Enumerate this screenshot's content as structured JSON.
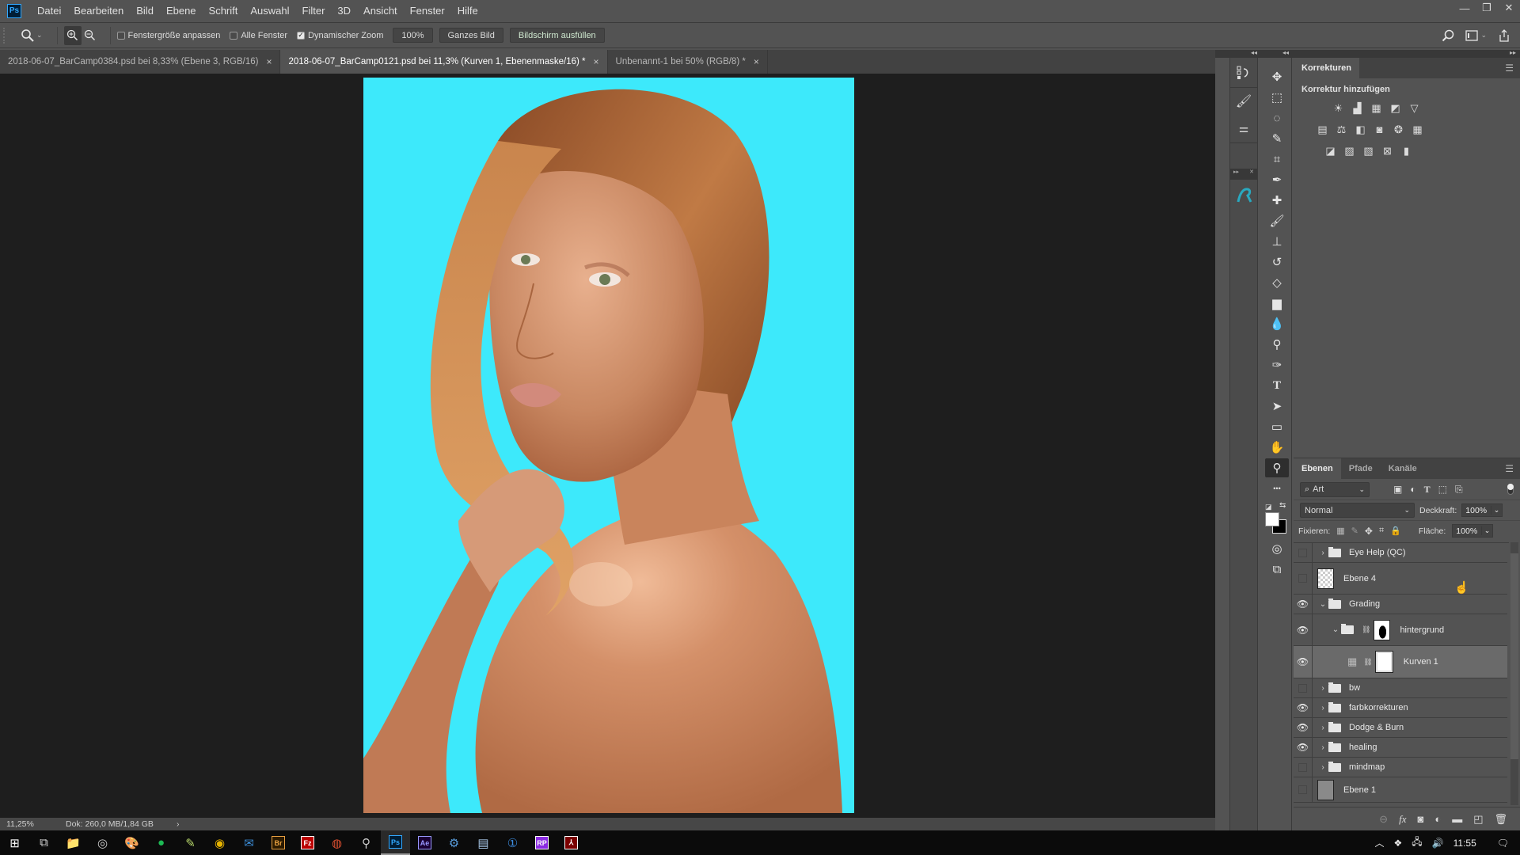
{
  "app": {
    "name": "Adobe Photoshop",
    "logo_text": "Ps"
  },
  "menu": [
    "Datei",
    "Bearbeiten",
    "Bild",
    "Ebene",
    "Schrift",
    "Auswahl",
    "Filter",
    "3D",
    "Ansicht",
    "Fenster",
    "Hilfe"
  ],
  "window_controls": {
    "minimize": "—",
    "restore": "❐",
    "close": "✕"
  },
  "options_bar": {
    "tool": "zoom",
    "fit_window_label": "Fenstergröße anpassen",
    "fit_window_checked": false,
    "all_windows_label": "Alle Fenster",
    "all_windows_checked": false,
    "dynamic_zoom_label": "Dynamischer Zoom",
    "dynamic_zoom_checked": true,
    "zoom_100_label": "100%",
    "fit_screen_label": "Ganzes Bild",
    "fill_screen_label": "Bildschirm ausfüllen"
  },
  "doc_tabs": [
    {
      "title": "2018-06-07_BarCamp0384.psd bei 8,33% (Ebene 3, RGB/16)",
      "active": false
    },
    {
      "title": "2018-06-07_BarCamp0121.psd bei 11,3% (Kurven 1, Ebenenmaske/16) *",
      "active": true
    },
    {
      "title": "Unbenannt-1 bei 50% (RGB/8) *",
      "active": false
    }
  ],
  "tab_close_glyph": "×",
  "canvas": {
    "background_color": "#3de9fb",
    "subject": "portrait of a red-haired woman with freckles looking over her shoulder"
  },
  "status": {
    "zoom": "11,25%",
    "doc_info": "Dok: 260,0 MB/1,84 GB",
    "arrow": "›"
  },
  "adjustments_panel": {
    "tab": "Korrekturen",
    "heading": "Korrektur hinzufügen",
    "rows": [
      [
        "brightness-contrast",
        "levels",
        "curves",
        "exposure",
        "vibrance"
      ],
      [
        "hue-saturation",
        "color-balance",
        "black-white",
        "photo-filter",
        "channel-mixer",
        "color-lookup"
      ],
      [
        "invert",
        "posterize",
        "threshold",
        "selective-color",
        "gradient-map"
      ]
    ]
  },
  "layers_panel": {
    "tabs": [
      {
        "label": "Ebenen",
        "active": true
      },
      {
        "label": "Pfade",
        "active": false
      },
      {
        "label": "Kanäle",
        "active": false
      }
    ],
    "filter_label": "Art",
    "blend_mode": "Normal",
    "opacity_label": "Deckkraft:",
    "opacity": "100%",
    "lock_label": "Fixieren:",
    "fill_label": "Fläche:",
    "fill": "100%",
    "layers": [
      {
        "name": "Eye Help (QC)",
        "type": "group",
        "visible": false,
        "expanded": false,
        "indent": 0
      },
      {
        "name": "Ebene 4",
        "type": "pixel",
        "visible": false,
        "thumb": "transparent",
        "indent": 0
      },
      {
        "name": "Grading",
        "type": "group",
        "visible": true,
        "expanded": true,
        "indent": 0
      },
      {
        "name": "hintergrund",
        "type": "group-with-mask",
        "visible": true,
        "expanded": true,
        "indent": 1
      },
      {
        "name": "Kurven 1",
        "type": "curves-adjustment",
        "visible": true,
        "selected": true,
        "indent": 2
      },
      {
        "name": "bw",
        "type": "group",
        "visible": false,
        "expanded": false,
        "indent": 0
      },
      {
        "name": "farbkorrekturen",
        "type": "group",
        "visible": true,
        "expanded": false,
        "indent": 0
      },
      {
        "name": "Dodge & Burn",
        "type": "group",
        "visible": true,
        "expanded": false,
        "indent": 0
      },
      {
        "name": "healing",
        "type": "group",
        "visible": true,
        "expanded": false,
        "indent": 0
      },
      {
        "name": "mindmap",
        "type": "group",
        "visible": false,
        "expanded": false,
        "indent": 0
      },
      {
        "name": "Ebene 1",
        "type": "pixel",
        "visible": false,
        "thumb": "gray",
        "indent": 0
      }
    ],
    "footer_icons": [
      "link-layers",
      "fx",
      "add-mask",
      "new-adjustment",
      "new-group",
      "new-layer",
      "delete-layer"
    ]
  },
  "tools": [
    "move",
    "marquee",
    "lasso",
    "quick-selection",
    "crop",
    "eyedropper",
    "healing-brush",
    "brush",
    "clone-stamp",
    "history-brush",
    "eraser",
    "gradient",
    "blur",
    "dodge",
    "pen",
    "type",
    "path-selection",
    "rectangle",
    "hand",
    "zoom",
    "more"
  ],
  "active_tool": "zoom",
  "colors": {
    "foreground": "#ffffff",
    "background": "#000000"
  },
  "taskbar": {
    "apps": [
      "start",
      "task-view",
      "file-explorer",
      "obs",
      "paint",
      "spotify",
      "notepad-plus",
      "chrome",
      "thunderbird",
      "bridge",
      "filezilla",
      "sorter",
      "network-tool",
      "photoshop",
      "after-effects",
      "steam",
      "notepad",
      "1password",
      "rp",
      "acrobat"
    ],
    "active_app": "photoshop",
    "labels": {
      "bridge": "Br",
      "filezilla": "Fz",
      "photoshop": "Ps",
      "after-effects": "Ae",
      "rp": "RP"
    },
    "clock": "11:55"
  }
}
